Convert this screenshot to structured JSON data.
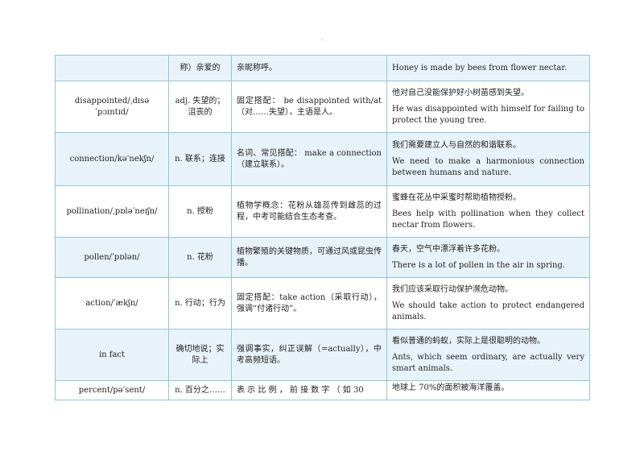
{
  "page": {
    "dot": "."
  },
  "rows": [
    {
      "word": "",
      "meaning": "称）亲爱的",
      "note": "亲昵称呼。",
      "example_zh": "",
      "example_en": "Honey is made by bees from flower nectar."
    },
    {
      "word": "disappointed/ˌdɪsəˈpɔɪntɪd/",
      "meaning": "adj. 失望的；沮丧的",
      "note": "固定搭配：  be disappointed with/at（对……失望），主语是人。",
      "example_zh": "他对自己没能保护好小树苗感到失望。",
      "example_en": "He was disappointed with himself for failing to protect the young tree."
    },
    {
      "word": "connection/kəˈnekʃn/",
      "meaning": "n. 联系；连接",
      "note": "名词、常见搭配：  make a connection（建立联系）。",
      "example_zh": "我们需要建立人与自然的和谐联系。",
      "example_en": "We need to make a harmonious connection between humans and nature."
    },
    {
      "word": "pollination/ˌpɒləˈneɪʃn/",
      "meaning": "n. 授粉",
      "note": "植物学概念：花粉从雄蕊传到雌蕊的过程，中考可能结合生态考查。",
      "example_zh": "蜜蜂在花丛中采蜜时帮助植物授粉。",
      "example_en": "Bees help with pollination when they collect nectar from flowers."
    },
    {
      "word": "pollen/ˈpɒlən/",
      "meaning": "n. 花粉",
      "note": "植物繁殖的关键物质，可通过风或昆虫传播。",
      "example_zh": "春天，空气中漂浮着许多花粉。",
      "example_en": "There is a lot of pollen in the air in spring."
    },
    {
      "word": "action/ˈækʃn/",
      "meaning": "n. 行动；行为",
      "note": "固定搭配：take action（采取行动），强调“付诸行动”。",
      "example_zh": "我们应该采取行动保护濒危动物。",
      "example_en": "We should take action to protect endangered animals."
    },
    {
      "word": "in fact",
      "meaning": "确切地说；实际上",
      "note": "强调事实，纠正误解（=actually），中考高频短语。",
      "example_zh": "看似普通的蚂蚁，实际上是很聪明的动物。",
      "example_en": "Ants, which seem ordinary, are actually very smart animals."
    },
    {
      "word": "percent/pəˈsent/",
      "meaning": "n. 百分之……",
      "note": "表 示 比 例 ， 前 接 数 字 （ 如 30",
      "example_zh": "地球上 70%的面积被海洋覆盖。",
      "example_en": ""
    }
  ]
}
